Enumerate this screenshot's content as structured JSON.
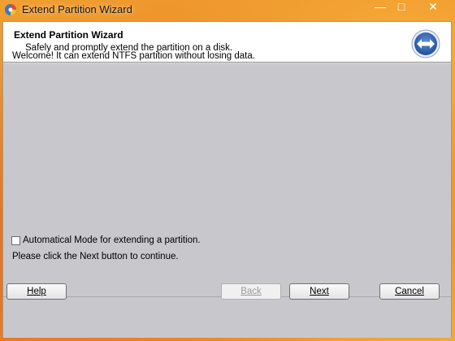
{
  "window": {
    "title": "Extend Partition Wizard",
    "controls": {
      "minimize": "—",
      "maximize": "□",
      "close": "✕"
    }
  },
  "header": {
    "title": "Extend Partition Wizard",
    "subtitle": "Safely and promptly extend the partition on a disk.",
    "icon": "extend-arrows-icon"
  },
  "main": {
    "welcome_text": "Welcome! It can extend NTFS partition without losing data.",
    "auto_mode_label": "Automatical Mode for extending a partition.",
    "auto_mode_checked": false,
    "hint_text": "Please click the Next button to continue."
  },
  "buttons": {
    "help": "Help",
    "back": "Back",
    "next": "Next",
    "cancel": "Cancel",
    "back_enabled": false
  },
  "colors": {
    "desktop_accent": "#e97b22",
    "dialog_bg": "#c8c8cc",
    "header_bg": "#ffffff",
    "icon_blue": "#2f5fa8"
  }
}
